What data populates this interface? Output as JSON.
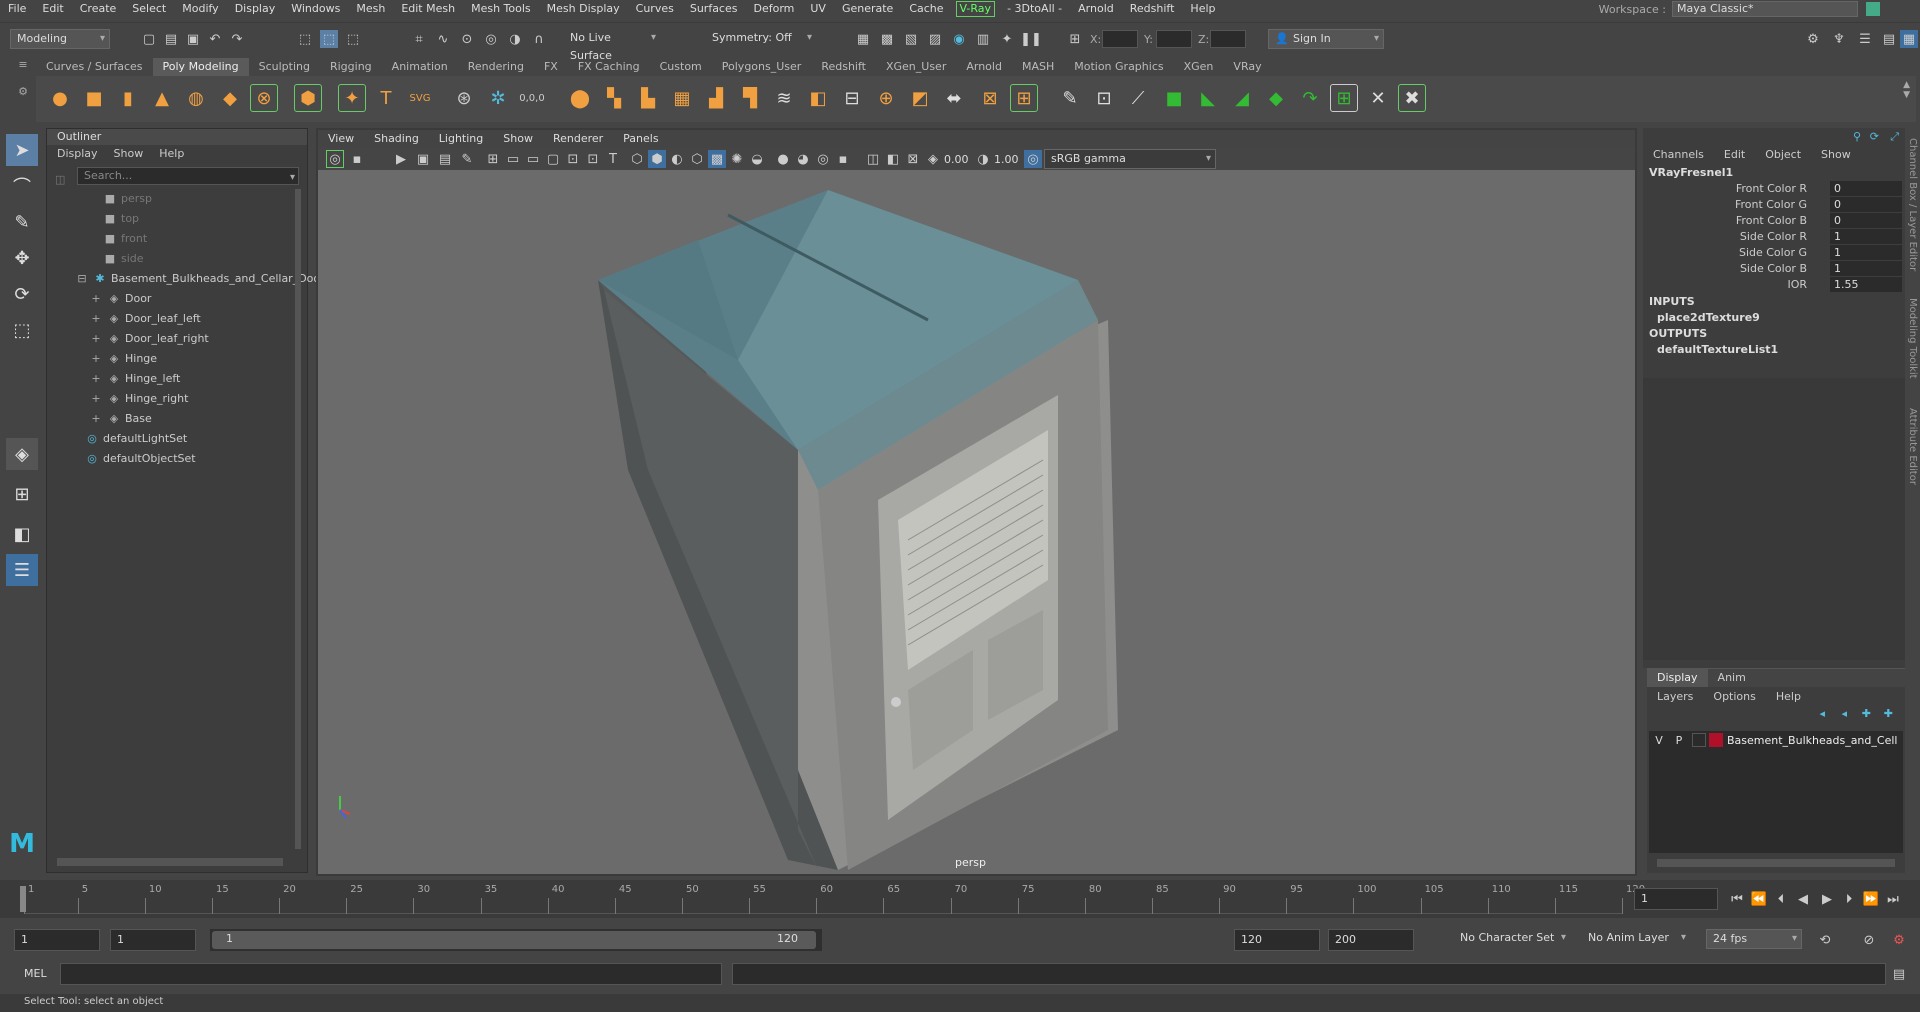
{
  "menubar": [
    "File",
    "Edit",
    "Create",
    "Select",
    "Modify",
    "Display",
    "Windows",
    "Mesh",
    "Edit Mesh",
    "Mesh Tools",
    "Mesh Display",
    "Curves",
    "Surfaces",
    "Deform",
    "UV",
    "Generate",
    "Cache",
    "V-Ray",
    "- 3DtoAll -",
    "Arnold",
    "Redshift",
    "Help"
  ],
  "workspace": {
    "label": "Workspace :",
    "value": "Maya Classic*"
  },
  "status": {
    "mode": "Modeling",
    "live_surface": "No Live Surface",
    "symmetry": "Symmetry: Off",
    "x_label": "X:",
    "y_label": "Y:",
    "z_label": "Z:",
    "sign_in": "Sign In"
  },
  "shelf_tabs": [
    "Curves / Surfaces",
    "Poly Modeling",
    "Sculpting",
    "Rigging",
    "Animation",
    "Rendering",
    "FX",
    "FX Caching",
    "Custom",
    "Polygons_User",
    "Redshift",
    "XGen_User",
    "Arnold",
    "MASH",
    "Motion Graphics",
    "XGen",
    "VRay"
  ],
  "shelf_active": "Poly Modeling",
  "outliner": {
    "title": "Outliner",
    "menu": [
      "Display",
      "Show",
      "Help"
    ],
    "search_placeholder": "Search...",
    "cameras": [
      "persp",
      "top",
      "front",
      "side"
    ],
    "group": "Basement_Bulkheads_and_Cellar_Doo",
    "children": [
      "Door",
      "Door_leaf_left",
      "Door_leaf_right",
      "Hinge",
      "Hinge_left",
      "Hinge_right",
      "Base"
    ],
    "sets": [
      "defaultLightSet",
      "defaultObjectSet"
    ]
  },
  "viewport": {
    "menu": [
      "View",
      "Shading",
      "Lighting",
      "Show",
      "Renderer",
      "Panels"
    ],
    "exposure": "0.00",
    "gamma": "1.00",
    "colorspace": "sRGB gamma",
    "camera_label": "persp"
  },
  "channel_box": {
    "menu": [
      "Channels",
      "Edit",
      "Object",
      "Show"
    ],
    "node": "VRayFresnel1",
    "attrs": [
      {
        "name": "Front Color R",
        "value": "0"
      },
      {
        "name": "Front Color G",
        "value": "0"
      },
      {
        "name": "Front Color B",
        "value": "0"
      },
      {
        "name": "Side Color R",
        "value": "1"
      },
      {
        "name": "Side Color G",
        "value": "1"
      },
      {
        "name": "Side Color B",
        "value": "1"
      },
      {
        "name": "IOR",
        "value": "1.55"
      }
    ],
    "inputs_label": "INPUTS",
    "input": "place2dTexture9",
    "outputs_label": "OUTPUTS",
    "output": "defaultTextureList1"
  },
  "side_tabs": [
    "Channel Box / Layer Editor",
    "Modeling Toolkit",
    "Attribute Editor"
  ],
  "layers": {
    "tabs": [
      "Display",
      "Anim"
    ],
    "menu": [
      "Layers",
      "Options",
      "Help"
    ],
    "layer": {
      "v": "V",
      "p": "P",
      "name": "Basement_Bulkheads_and_Cell",
      "color": "#b0102a"
    }
  },
  "timeline": {
    "ticks": [
      "1",
      "5",
      "10",
      "15",
      "20",
      "25",
      "30",
      "35",
      "40",
      "45",
      "50",
      "55",
      "60",
      "65",
      "70",
      "75",
      "80",
      "85",
      "90",
      "95",
      "100",
      "105",
      "110",
      "115",
      "120"
    ],
    "current": "1"
  },
  "range": {
    "start": "1",
    "start_inner": "1",
    "slider_start": "1",
    "slider_end": "120",
    "end_inner": "120",
    "end": "200",
    "character_set": "No Character Set",
    "anim_layer": "No Anim Layer",
    "fps": "24 fps"
  },
  "cmdline": {
    "label": "MEL"
  },
  "help_line": "Select Tool: select an object"
}
